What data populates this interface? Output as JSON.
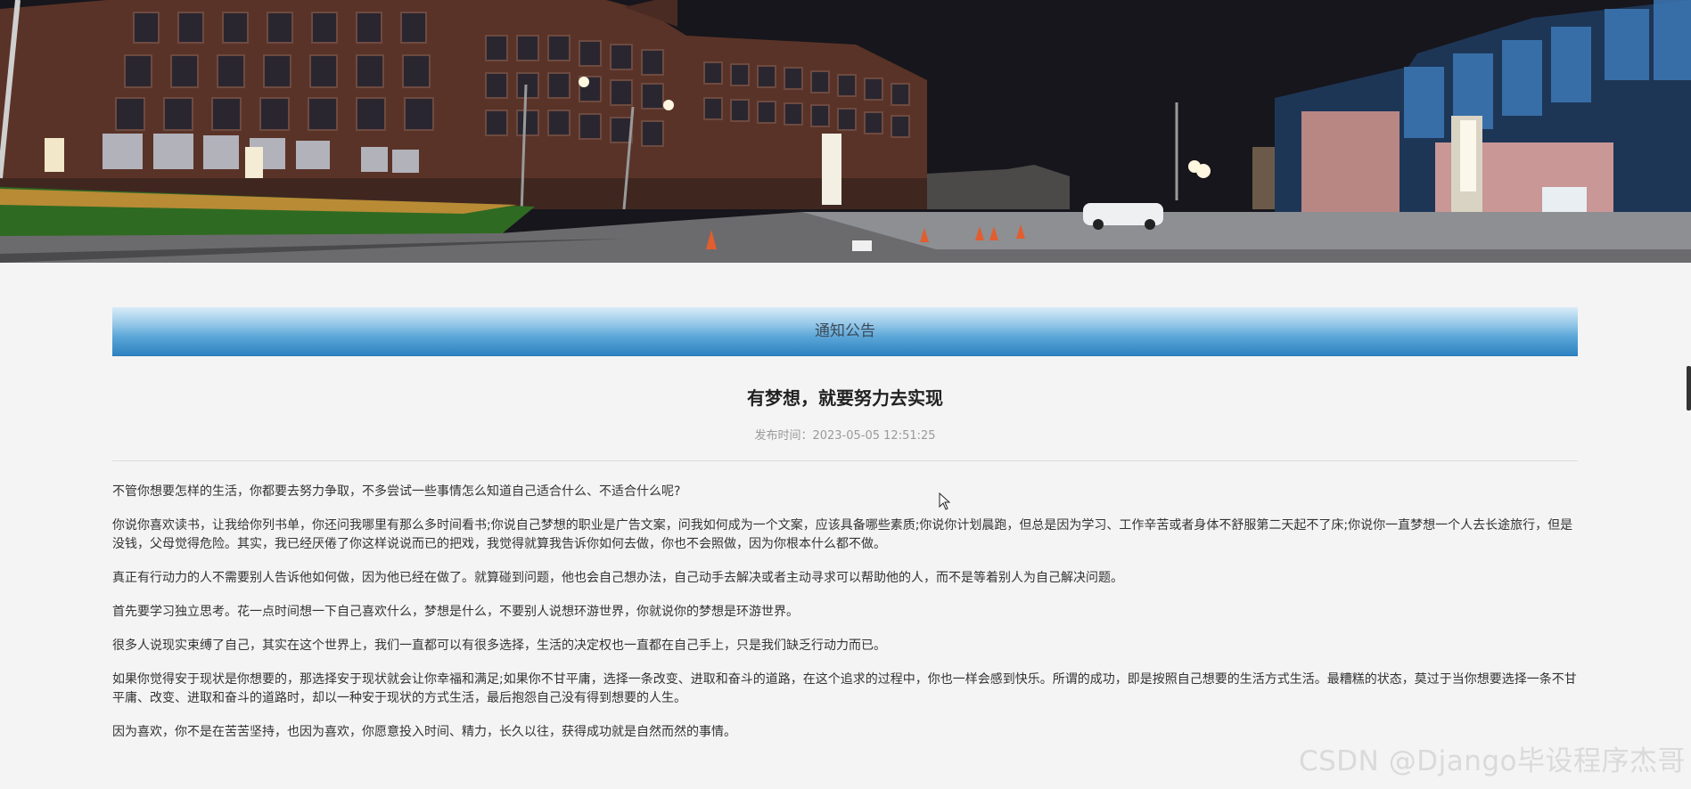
{
  "banner": {
    "image_description_icon": "campus-night-photo"
  },
  "section": {
    "title": "通知公告"
  },
  "article": {
    "title": "有梦想，就要努力去实现",
    "meta_label": "发布时间：",
    "date": "2023-05-05 12:51:25",
    "paragraphs": [
      "不管你想要怎样的生活，你都要去努力争取，不多尝试一些事情怎么知道自己适合什么、不适合什么呢?",
      "你说你喜欢读书，让我给你列书单，你还问我哪里有那么多时间看书;你说自己梦想的职业是广告文案，问我如何成为一个文案，应该具备哪些素质;你说你计划晨跑，但总是因为学习、工作辛苦或者身体不舒服第二天起不了床;你说你一直梦想一个人去长途旅行，但是没钱，父母觉得危险。其实，我已经厌倦了你这样说说而已的把戏，我觉得就算我告诉你如何去做，你也不会照做，因为你根本什么都不做。",
      "真正有行动力的人不需要别人告诉他如何做，因为他已经在做了。就算碰到问题，他也会自己想办法，自己动手去解决或者主动寻求可以帮助他的人，而不是等着别人为自己解决问题。",
      "首先要学习独立思考。花一点时间想一下自己喜欢什么，梦想是什么，不要别人说想环游世界，你就说你的梦想是环游世界。",
      "很多人说现实束缚了自己，其实在这个世界上，我们一直都可以有很多选择，生活的决定权也一直都在自己手上，只是我们缺乏行动力而已。",
      "如果你觉得安于现状是你想要的，那选择安于现状就会让你幸福和满足;如果你不甘平庸，选择一条改变、进取和奋斗的道路，在这个追求的过程中，你也一样会感到快乐。所谓的成功，即是按照自己想要的生活方式生活。最糟糕的状态，莫过于当你想要选择一条不甘平庸、改变、进取和奋斗的道路时，却以一种安于现状的方式生活，最后抱怨自己没有得到想要的人生。",
      "因为喜欢，你不是在苦苦坚持，也因为喜欢，你愿意投入时间、精力，长久以往，获得成功就是自然而然的事情。"
    ]
  },
  "watermark": {
    "text": "CSDN @Django毕设程序杰哥"
  },
  "colors": {
    "bar_top": "#d8ecf8",
    "bar_bottom": "#2d82c0",
    "page_bg": "#f4f4f4"
  }
}
